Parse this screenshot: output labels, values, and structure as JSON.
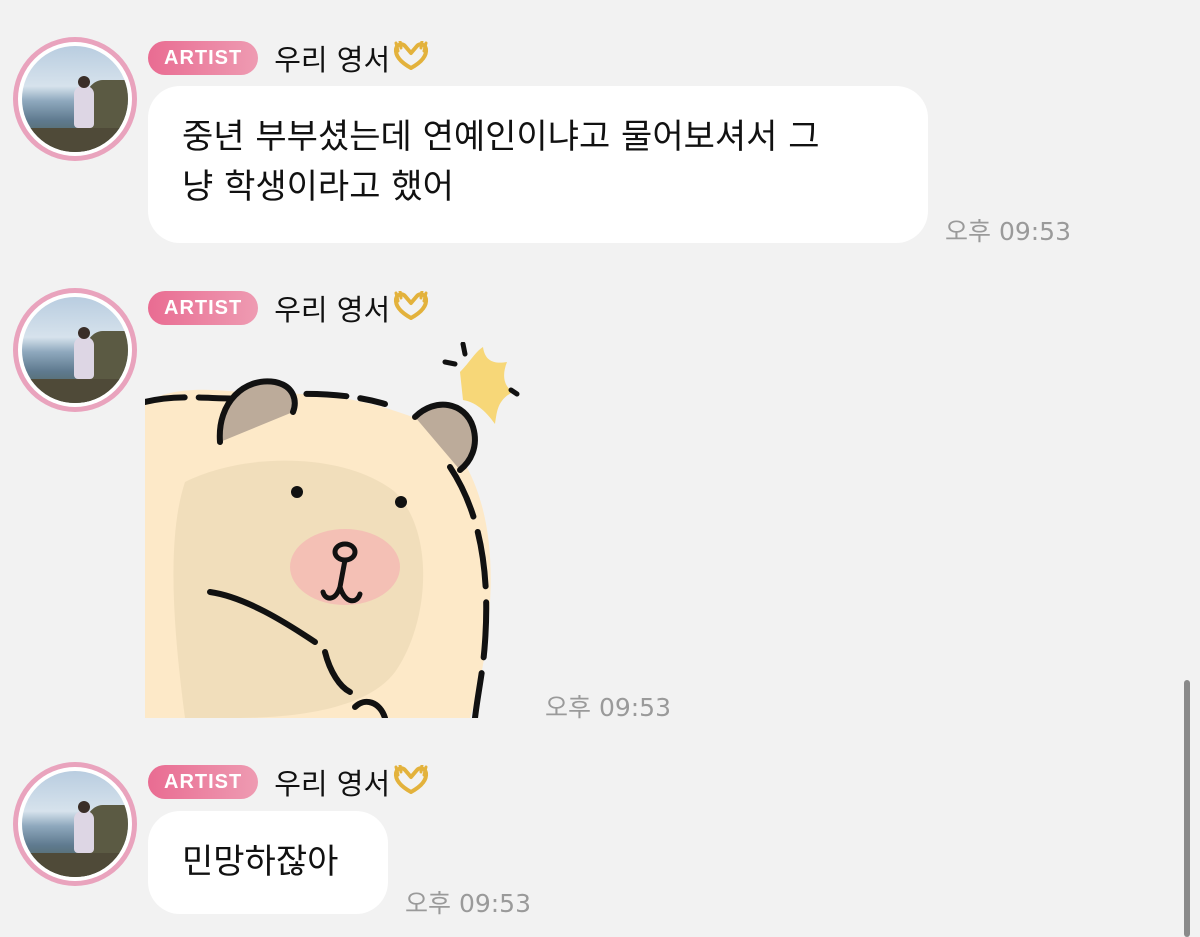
{
  "messages": [
    {
      "badge": "ARTIST",
      "sender": "우리 영서",
      "sender_emoji": "heart-hands-icon",
      "text_lines": [
        "중년 부부셨는데 연예인이냐고 물어보셔서 그",
        "냥 학생이라고 했어"
      ],
      "time": "오후 09:53"
    },
    {
      "badge": "ARTIST",
      "sender": "우리 영서",
      "sender_emoji": "heart-hands-icon",
      "sticker": "hamster-sticker",
      "time": "오후 09:53"
    },
    {
      "badge": "ARTIST",
      "sender": "우리 영서",
      "sender_emoji": "heart-hands-icon",
      "text_lines": [
        "민망하잖아"
      ],
      "time": "오후 09:53"
    }
  ],
  "colors": {
    "background": "#f2f2f2",
    "badge_gradient_start": "#e96c92",
    "badge_gradient_end": "#ee9bb2",
    "bubble": "#ffffff",
    "timestamp": "#9a9a9a"
  }
}
